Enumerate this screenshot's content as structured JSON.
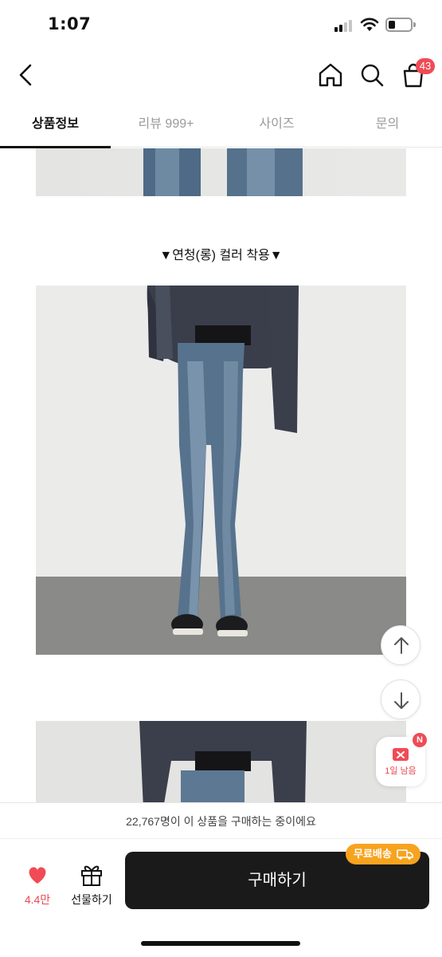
{
  "status_bar": {
    "time": "1:07"
  },
  "header": {
    "cart_count": "43"
  },
  "tabs": [
    {
      "label": "상품정보",
      "active": true
    },
    {
      "label": "리뷰 999+",
      "active": false
    },
    {
      "label": "사이즈",
      "active": false
    },
    {
      "label": "문의",
      "active": false
    }
  ],
  "content": {
    "caption": "▼연청(롱) 컬러 착용▼"
  },
  "coupon": {
    "badge": "N",
    "label": "1일 남음"
  },
  "buyers_text": "22,767명이 이 상품을 구매하는 중이에요",
  "bottom": {
    "like_count": "4.4만",
    "gift_label": "선물하기",
    "buy_label": "구매하기",
    "shipping_badge": "무료배송"
  },
  "colors": {
    "accent": "#f04b55",
    "buy_button": "#1a1a1a",
    "shipping_badge": "#f7a31f"
  },
  "icons": [
    "back-icon",
    "home-icon",
    "search-icon",
    "cart-icon",
    "arrow-up-icon",
    "arrow-down-icon",
    "coupon-icon",
    "heart-icon",
    "gift-icon",
    "truck-icon"
  ]
}
